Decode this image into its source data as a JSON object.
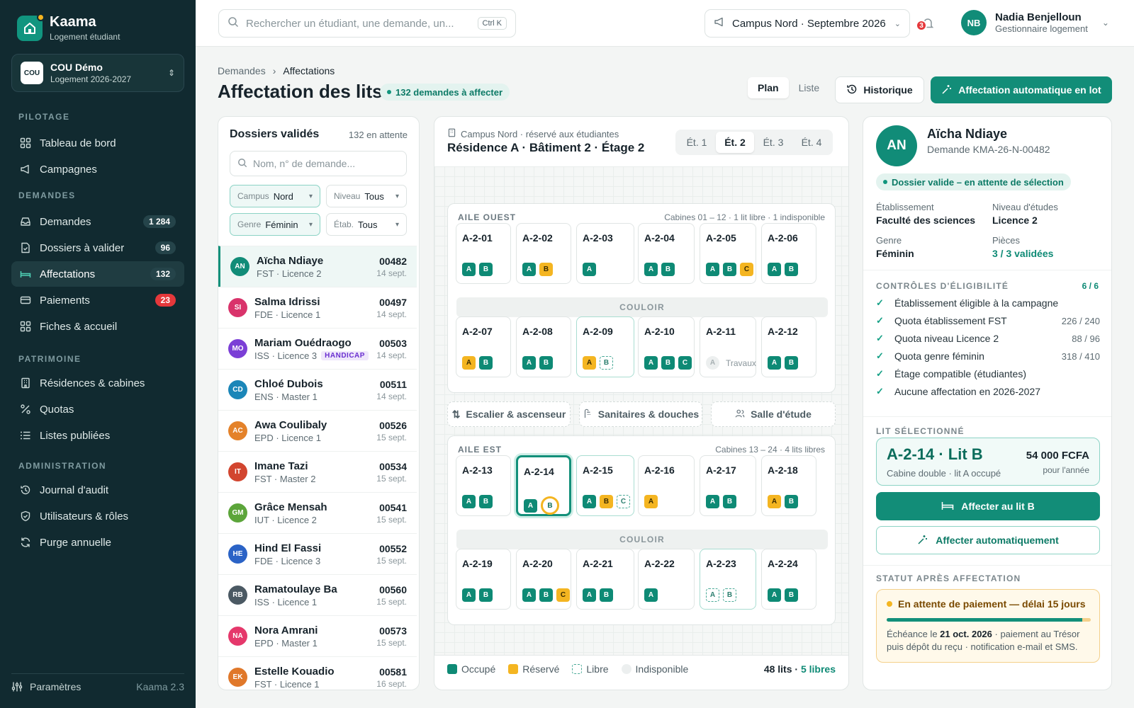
{
  "brand": {
    "name": "Kaama",
    "sub": "Logement étudiant"
  },
  "org": {
    "badge": "COU",
    "name": "COU Démo",
    "sub": "Logement 2026-2027"
  },
  "nav": {
    "sec_pilotage": "PILOTAGE",
    "sec_demandes": "DEMANDES",
    "sec_patrimoine": "PATRIMOINE",
    "sec_admin": "ADMINISTRATION",
    "items": [
      {
        "label": "Tableau de bord"
      },
      {
        "label": "Campagnes"
      },
      {
        "label": "Demandes",
        "badge": "1 284"
      },
      {
        "label": "Dossiers à valider",
        "badge": "96"
      },
      {
        "label": "Affectations",
        "badge": "132"
      },
      {
        "label": "Paiements",
        "badge": "23"
      },
      {
        "label": "Fiches & accueil"
      },
      {
        "label": "Résidences & cabines"
      },
      {
        "label": "Quotas"
      },
      {
        "label": "Listes publiées"
      },
      {
        "label": "Journal d'audit"
      },
      {
        "label": "Utilisateurs & rôles"
      },
      {
        "label": "Purge annuelle"
      }
    ],
    "footer_label": "Paramètres",
    "version": "Kaama 2.3"
  },
  "topbar": {
    "search_placeholder": "Rechercher un étudiant, une demande, un...",
    "shortcut": "Ctrl K",
    "campus": "Campus Nord · Septembre 2026",
    "notif_count": "3",
    "user_initials": "NB",
    "user_name": "Nadia Benjelloun",
    "user_role": "Gestionnaire logement"
  },
  "header": {
    "crumb_root": "Demandes",
    "crumb_current": "Affectations",
    "title": "Affectation des lits",
    "pending": "132 demandes à affecter",
    "view_plan": "Plan",
    "view_list": "Liste",
    "history": "Historique",
    "auto_batch": "Affectation automatique en lot"
  },
  "dossiers": {
    "title": "Dossiers validés",
    "count": "132 en attente",
    "search_placeholder": "Nom, n° de demande...",
    "filters": {
      "campus_k": "Campus",
      "campus_v": "Nord",
      "niveau_k": "Niveau",
      "niveau_v": "Tous",
      "genre_k": "Genre",
      "genre_v": "Féminin",
      "etab_k": "Étab.",
      "etab_v": "Tous"
    },
    "students": [
      {
        "initials": "AN",
        "color": "#118c78",
        "name": "Aïcha Ndiaye",
        "sub": "FST · Licence 2",
        "num": "00482",
        "date": "14 sept."
      },
      {
        "initials": "SI",
        "color": "#d9336b",
        "name": "Salma Idrissi",
        "sub": "FDE · Licence 1",
        "num": "00497",
        "date": "14 sept."
      },
      {
        "initials": "MO",
        "color": "#7b3fd6",
        "name": "Mariam Ouédraogo",
        "sub": "ISS · Licence 3",
        "tag": "HANDICAP",
        "num": "00503",
        "date": "14 sept."
      },
      {
        "initials": "CD",
        "color": "#1b86b8",
        "name": "Chloé Dubois",
        "sub": "ENS · Master 1",
        "num": "00511",
        "date": "14 sept."
      },
      {
        "initials": "AC",
        "color": "#e4822a",
        "name": "Awa Coulibaly",
        "sub": "EPD · Licence 1",
        "num": "00526",
        "date": "15 sept."
      },
      {
        "initials": "IT",
        "color": "#d2452f",
        "name": "Imane Tazi",
        "sub": "FST · Master 2",
        "num": "00534",
        "date": "15 sept."
      },
      {
        "initials": "GM",
        "color": "#5ca53a",
        "name": "Grâce Mensah",
        "sub": "IUT · Licence 2",
        "num": "00541",
        "date": "15 sept."
      },
      {
        "initials": "HE",
        "color": "#2b63c6",
        "name": "Hind El Fassi",
        "sub": "FDE · Licence 3",
        "num": "00552",
        "date": "15 sept."
      },
      {
        "initials": "RB",
        "color": "#4b5963",
        "name": "Ramatoulaye Ba",
        "sub": "ISS · Licence 1",
        "num": "00560",
        "date": "15 sept."
      },
      {
        "initials": "NA",
        "color": "#e5386b",
        "name": "Nora Amrani",
        "sub": "EPD · Master 1",
        "num": "00573",
        "date": "15 sept."
      },
      {
        "initials": "EK",
        "color": "#e0782a",
        "name": "Estelle Kouadio",
        "sub": "FST · Licence 1",
        "num": "00581",
        "date": "16 sept."
      }
    ]
  },
  "plan": {
    "meta": "Campus Nord · réservé aux étudiantes",
    "title": "Résidence A · Bâtiment 2 · Étage 2",
    "floors": [
      "Ét. 1",
      "Ét. 2",
      "Ét. 3",
      "Ét. 4"
    ],
    "west_label": "AILE OUEST",
    "west_meta": "Cabines 01 – 12 · 1 lit libre · 1 indisponible",
    "east_label": "AILE EST",
    "east_meta": "Cabines 13 – 24 · 4 lits libres",
    "corridor": "COULOIR",
    "amen_stairs": "Escalier & ascenseur",
    "amen_sanitary": "Sanitaires & douches",
    "amen_study": "Salle d'étude",
    "travaux": "Travaux",
    "cabins": [
      {
        "no": "A-2-01",
        "beds": [
          [
            "A",
            "o"
          ],
          [
            "B",
            "o"
          ]
        ]
      },
      {
        "no": "A-2-02",
        "beds": [
          [
            "A",
            "o"
          ],
          [
            "B",
            "r"
          ]
        ]
      },
      {
        "no": "A-2-03",
        "beds": [
          [
            "A",
            "o"
          ]
        ]
      },
      {
        "no": "A-2-04",
        "beds": [
          [
            "A",
            "o"
          ],
          [
            "B",
            "o"
          ]
        ]
      },
      {
        "no": "A-2-05",
        "beds": [
          [
            "A",
            "o"
          ],
          [
            "B",
            "o"
          ],
          [
            "C",
            "r"
          ]
        ]
      },
      {
        "no": "A-2-06",
        "beds": [
          [
            "A",
            "o"
          ],
          [
            "B",
            "o"
          ]
        ]
      },
      {
        "no": "A-2-07",
        "beds": [
          [
            "A",
            "r"
          ],
          [
            "B",
            "o"
          ]
        ]
      },
      {
        "no": "A-2-08",
        "beds": [
          [
            "A",
            "o"
          ],
          [
            "B",
            "o"
          ]
        ]
      },
      {
        "no": "A-2-09",
        "beds": [
          [
            "A",
            "r"
          ],
          [
            "B",
            "l"
          ]
        ]
      },
      {
        "no": "A-2-10",
        "beds": [
          [
            "A",
            "o"
          ],
          [
            "B",
            "o"
          ],
          [
            "C",
            "o"
          ]
        ]
      },
      {
        "no": "A-2-11",
        "beds": [
          [
            "A",
            "u"
          ]
        ]
      },
      {
        "no": "A-2-12",
        "beds": [
          [
            "A",
            "o"
          ],
          [
            "B",
            "o"
          ]
        ]
      },
      {
        "no": "A-2-13",
        "beds": [
          [
            "A",
            "o"
          ],
          [
            "B",
            "o"
          ]
        ]
      },
      {
        "no": "A-2-14",
        "beds": [
          [
            "A",
            "o"
          ],
          [
            "B",
            "sel"
          ]
        ]
      },
      {
        "no": "A-2-15",
        "beds": [
          [
            "A",
            "o"
          ],
          [
            "B",
            "r"
          ],
          [
            "C",
            "l"
          ]
        ]
      },
      {
        "no": "A-2-16",
        "beds": [
          [
            "A",
            "r"
          ]
        ]
      },
      {
        "no": "A-2-17",
        "beds": [
          [
            "A",
            "o"
          ],
          [
            "B",
            "o"
          ]
        ]
      },
      {
        "no": "A-2-18",
        "beds": [
          [
            "A",
            "r"
          ],
          [
            "B",
            "o"
          ]
        ]
      },
      {
        "no": "A-2-19",
        "beds": [
          [
            "A",
            "o"
          ],
          [
            "B",
            "o"
          ]
        ]
      },
      {
        "no": "A-2-20",
        "beds": [
          [
            "A",
            "o"
          ],
          [
            "B",
            "o"
          ],
          [
            "C",
            "r"
          ]
        ]
      },
      {
        "no": "A-2-21",
        "beds": [
          [
            "A",
            "o"
          ],
          [
            "B",
            "o"
          ]
        ]
      },
      {
        "no": "A-2-22",
        "beds": [
          [
            "A",
            "o"
          ]
        ]
      },
      {
        "no": "A-2-23",
        "beds": [
          [
            "A",
            "l"
          ],
          [
            "B",
            "l"
          ]
        ]
      },
      {
        "no": "A-2-24",
        "beds": [
          [
            "A",
            "o"
          ],
          [
            "B",
            "o"
          ]
        ]
      }
    ],
    "legend": {
      "occupied": "Occupé",
      "reserved": "Réservé",
      "free": "Libre",
      "unavailable": "Indisponible"
    },
    "capacity": "48 lits",
    "free_beds": "5 libres"
  },
  "colors": {
    "occupied": "#0e8a75",
    "reserved": "#f4b521",
    "free": "#4aaa97",
    "unavailable": "#ecefef"
  },
  "detail": {
    "initials": "AN",
    "name": "Aïcha Ndiaye",
    "request": "Demande KMA-26-N-00482",
    "status": "Dossier valide – en attente de sélection",
    "etab_k": "Établissement",
    "etab_v": "Faculté des sciences",
    "niveau_k": "Niveau d'études",
    "niveau_v": "Licence 2",
    "genre_k": "Genre",
    "genre_v": "Féminin",
    "pieces_k": "Pièces",
    "pieces_v": "3 / 3 validées",
    "checks_label": "CONTRÔLES D'ÉLIGIBILITÉ",
    "checks_score": "6 / 6",
    "checks": [
      {
        "label": "Établissement éligible à la campagne",
        "value": ""
      },
      {
        "label": "Quota établissement FST",
        "value": "226 / 240"
      },
      {
        "label": "Quota niveau Licence 2",
        "value": "88 / 96"
      },
      {
        "label": "Quota genre féminin",
        "value": "318 / 410"
      },
      {
        "label": "Étage compatible (étudiantes)",
        "value": ""
      },
      {
        "label": "Aucune affectation en 2026-2027",
        "value": ""
      }
    ],
    "bed_label": "LIT SÉLECTIONNÉ",
    "bed_title": "A-2-14 · Lit B",
    "bed_sub": "Cabine double · lit A occupé",
    "price": "54 000 FCFA",
    "price_per": "pour l'année",
    "assign_btn": "Affecter au lit B",
    "auto_btn": "Affecter automatiquement",
    "after_label": "STATUT APRÈS AFFECTATION",
    "pay_title": "En attente de paiement — délai 15 jours",
    "pay_pre": "Échéance le ",
    "pay_date": "21 oct. 2026",
    "pay_post": " · paiement au Trésor puis dépôt du reçu · notification e-mail et SMS."
  }
}
